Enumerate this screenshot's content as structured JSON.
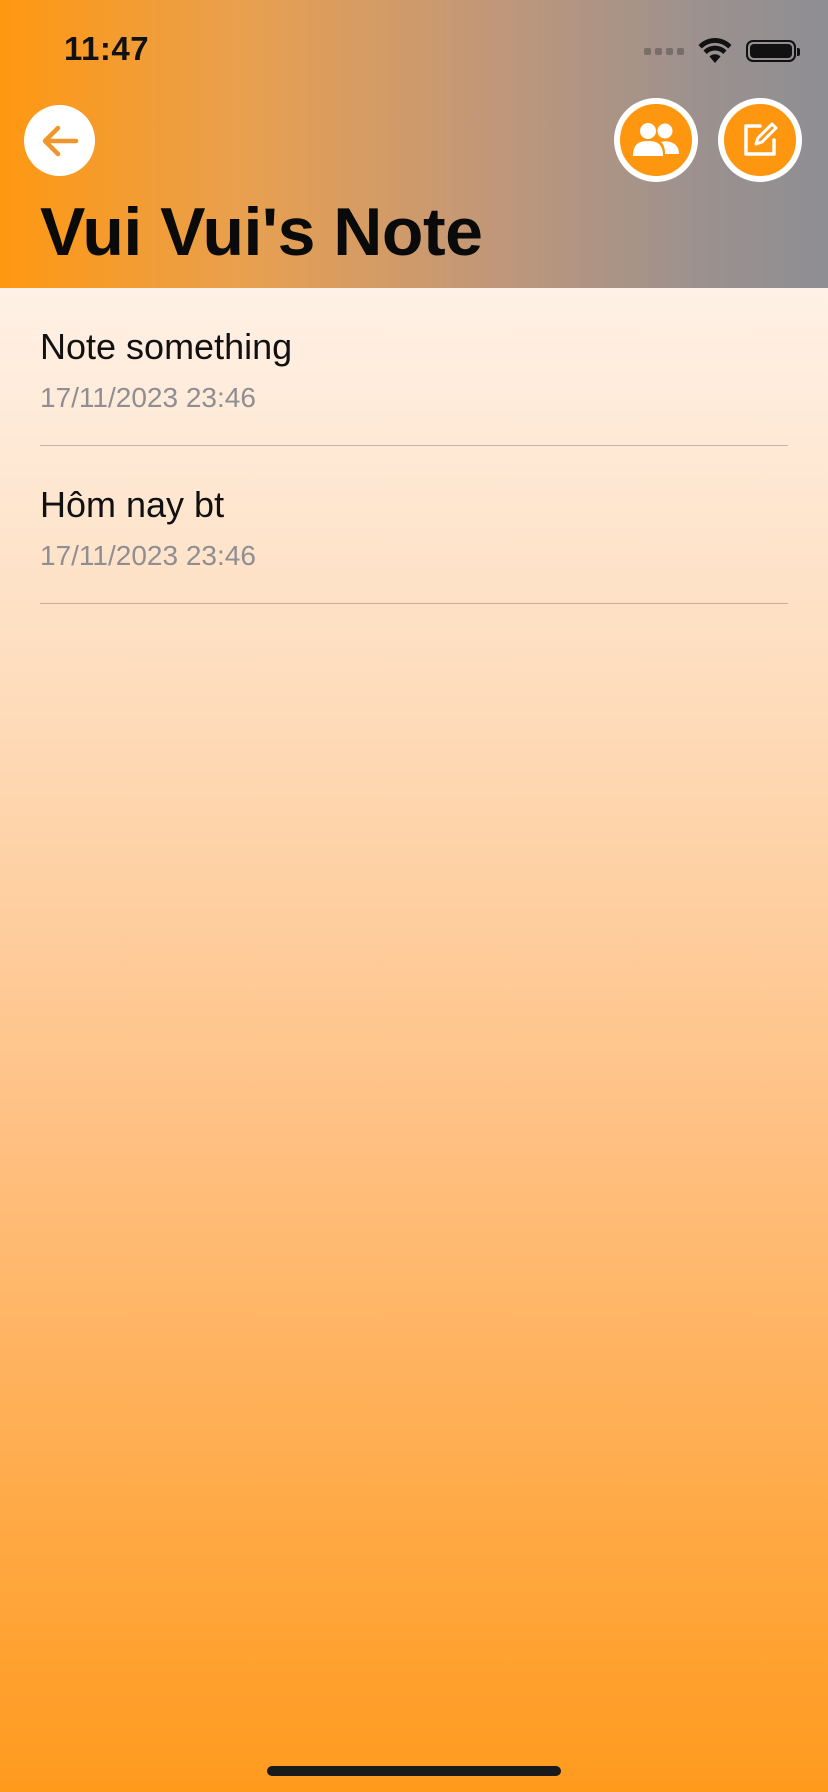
{
  "status_bar": {
    "time": "11:47",
    "icons": [
      "cellular-signal-icon",
      "wifi-icon",
      "battery-icon"
    ]
  },
  "nav": {
    "back_icon": "arrow-left-icon",
    "share_icon": "people-icon",
    "compose_icon": "compose-icon"
  },
  "page": {
    "title": "Vui Vui's Note"
  },
  "notes": [
    {
      "title": "Note something",
      "date": "17/11/2023 23:46"
    },
    {
      "title": "Hôm nay bt",
      "date": "17/11/2023 23:46"
    }
  ],
  "colors": {
    "accent": "#ff9610",
    "header_gradient_start": "#ff9811",
    "header_gradient_end": "#8e8e93",
    "secondary_text": "#8e8e93"
  }
}
